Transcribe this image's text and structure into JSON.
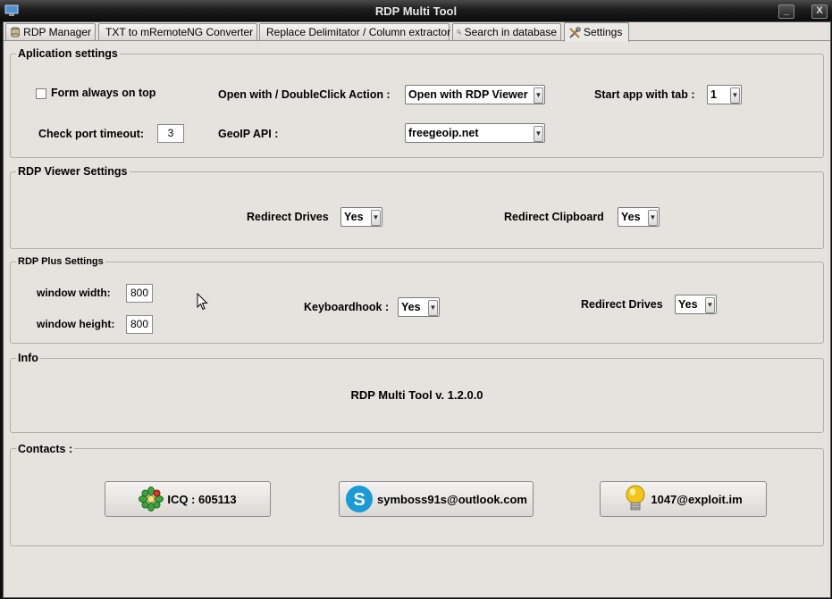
{
  "window": {
    "title": "RDP Multi Tool",
    "minimize": "_",
    "close": "X"
  },
  "tabs": [
    {
      "label": "RDP Manager",
      "icon": "database-icon"
    },
    {
      "label": "TXT to mRemoteNG Converter",
      "icon": "terminal-icon"
    },
    {
      "label": "Replace Delimitator / Column extractor",
      "icon": "refresh-icon"
    },
    {
      "label": "Search in database",
      "icon": "search-icon"
    },
    {
      "label": "Settings",
      "icon": "tools-icon",
      "active": true
    }
  ],
  "app_settings": {
    "title": "Aplication settings",
    "form_on_top_label": "Form always on top",
    "form_on_top_checked": false,
    "open_with_label": "Open with / DoubleClick Action :",
    "open_with_value": "Open with RDP Viewer",
    "start_tab_label": "Start app with tab :",
    "start_tab_value": "1",
    "port_timeout_label": "Check port timeout:",
    "port_timeout_value": "3",
    "geoip_label": "GeoIP API :",
    "geoip_value": "freegeoip.net"
  },
  "rdp_viewer": {
    "title": "RDP Viewer Settings",
    "redirect_drives_label": "Redirect Drives",
    "redirect_drives_value": "Yes",
    "redirect_clipboard_label": "Redirect Clipboard",
    "redirect_clipboard_value": "Yes"
  },
  "rdp_plus": {
    "title": "RDP Plus Settings",
    "width_label": "window width:",
    "width_value": "800",
    "height_label": "window height:",
    "height_value": "800",
    "keyboardhook_label": "Keyboardhook :",
    "keyboardhook_value": "Yes",
    "redirect_drives_label": "Redirect Drives",
    "redirect_drives_value": "Yes"
  },
  "info": {
    "title": "Info",
    "version": "RDP Multi Tool v. 1.2.0.0"
  },
  "contacts": {
    "title": "Contacts :",
    "icq": "ICQ : 605113",
    "skype": "symboss91s@outlook.com",
    "jabber": "1047@exploit.im"
  },
  "colors": {
    "panel": "#e6e3de",
    "titlebar": "#1d1d1d",
    "icq_green": "#3fa43f",
    "skype_blue": "#1a9ad6",
    "bulb_yellow": "#f5c518"
  }
}
